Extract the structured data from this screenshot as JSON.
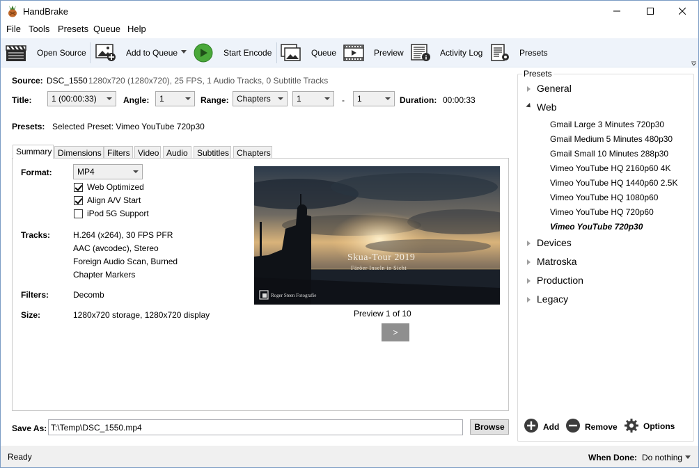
{
  "window": {
    "title": "HandBrake"
  },
  "menu": [
    "File",
    "Tools",
    "Presets",
    "Queue",
    "Help"
  ],
  "toolbar": {
    "open_source": "Open Source",
    "add_to_queue": "Add to Queue",
    "start_encode": "Start Encode",
    "queue": "Queue",
    "preview": "Preview",
    "activity_log": "Activity Log",
    "presets": "Presets"
  },
  "source": {
    "label": "Source:",
    "name": "DSC_1550",
    "info": "1280x720 (1280x720), 25 FPS, 1 Audio Tracks, 0 Subtitle Tracks"
  },
  "title_row": {
    "title_label": "Title:",
    "title_value": "1 (00:00:33)",
    "angle_label": "Angle:",
    "angle_value": "1",
    "range_label": "Range:",
    "range_value": "Chapters",
    "range_start": "1",
    "range_dash": "-",
    "range_end": "1",
    "duration_label": "Duration:",
    "duration_value": "00:00:33"
  },
  "presets_row": {
    "label": "Presets:",
    "value": "Selected Preset:  Vimeo YouTube 720p30"
  },
  "tabs": [
    "Summary",
    "Dimensions",
    "Filters",
    "Video",
    "Audio",
    "Subtitles",
    "Chapters"
  ],
  "summary": {
    "format_label": "Format:",
    "format_value": "MP4",
    "web_optimized": "Web Optimized",
    "align_av": "Align A/V Start",
    "ipod": "iPod 5G Support",
    "tracks_label": "Tracks:",
    "tracks": [
      "H.264 (x264), 30 FPS PFR",
      "AAC (avcodec), Stereo",
      "Foreign Audio Scan, Burned",
      "Chapter Markers"
    ],
    "filters_label": "Filters:",
    "filters_value": "Decomb",
    "size_label": "Size:",
    "size_value": "1280x720 storage, 1280x720 display"
  },
  "preview": {
    "overlay_title": "Skua-Tour 2019",
    "overlay_subtitle": "Färöer Inseln in Sicht",
    "watermark": "Roger Steen Fotografie",
    "caption": "Preview 1 of 10",
    "next_button": ">"
  },
  "save_as": {
    "label": "Save As:",
    "value": "T:\\Temp\\DSC_1550.mp4",
    "browse": "Browse"
  },
  "presets_panel": {
    "title": "Presets",
    "categories": {
      "general": "General",
      "web": "Web",
      "devices": "Devices",
      "matroska": "Matroska",
      "production": "Production",
      "legacy": "Legacy"
    },
    "web_items": [
      "Gmail Large 3 Minutes 720p30",
      "Gmail Medium 5 Minutes 480p30",
      "Gmail Small 10 Minutes 288p30",
      "Vimeo YouTube HQ 2160p60 4K",
      "Vimeo YouTube HQ 1440p60 2.5K",
      "Vimeo YouTube HQ 1080p60",
      "Vimeo YouTube HQ 720p60",
      "Vimeo YouTube 720p30"
    ],
    "add": "Add",
    "remove": "Remove",
    "options": "Options"
  },
  "status": {
    "text": "Ready",
    "when_done_label": "When Done:",
    "when_done_value": "Do nothing"
  },
  "colors": {
    "accent": "#2e7d32",
    "toolbar_bg": "#eef3fa"
  }
}
